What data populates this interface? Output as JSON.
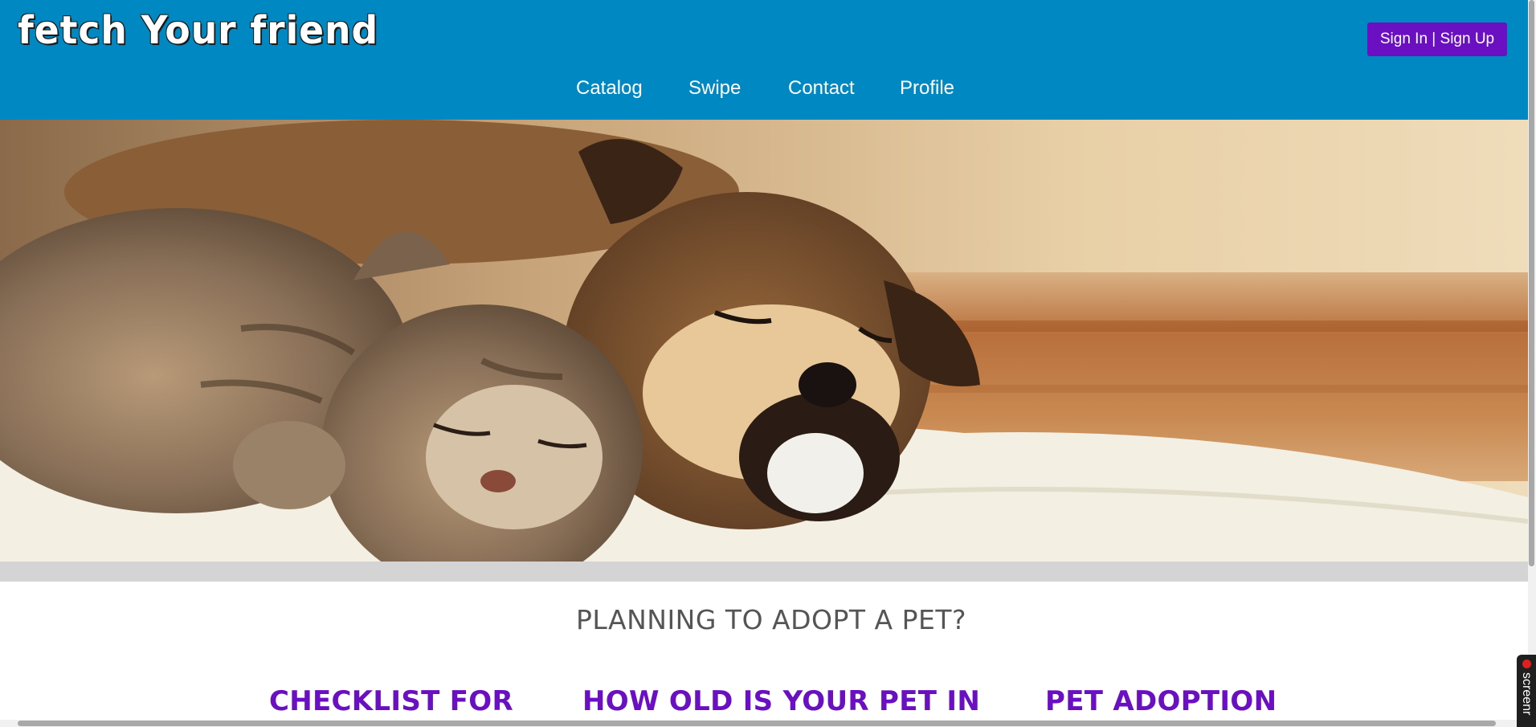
{
  "header": {
    "logo_text": "fetch Your friend",
    "signin_label": "Sign In | Sign Up",
    "nav": [
      {
        "label": "Catalog"
      },
      {
        "label": "Swipe"
      },
      {
        "label": "Contact"
      },
      {
        "label": "Profile"
      }
    ]
  },
  "hero": {
    "image_alt": "sleeping kitten and puppy on a white blanket"
  },
  "main": {
    "section_title": "PLANNING TO ADOPT A PET?",
    "cards": [
      {
        "title": "CHECKLIST FOR"
      },
      {
        "title": "HOW OLD IS YOUR PET IN"
      },
      {
        "title": "PET ADOPTION"
      }
    ]
  },
  "recorder": {
    "label": "screenr"
  },
  "colors": {
    "header_bg": "#0088c2",
    "accent_purple": "#6a0fc2",
    "band_gray": "#d4d4d4",
    "title_gray": "#555555"
  }
}
